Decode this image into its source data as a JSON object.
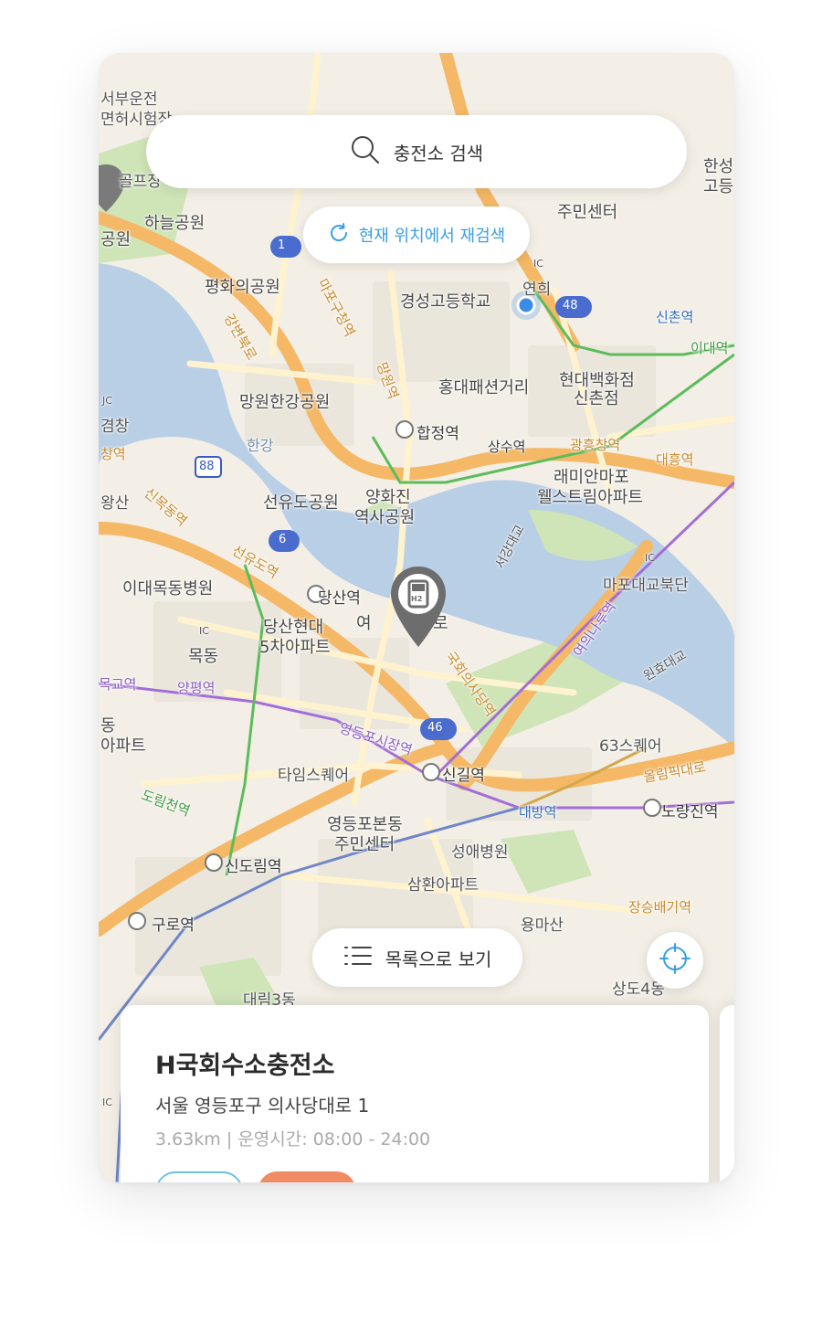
{
  "search": {
    "placeholder": "충전소 검색",
    "icon": "search-icon"
  },
  "rescan_button": {
    "label": "현재 위치에서 재검색",
    "icon": "refresh-icon"
  },
  "list_button": {
    "label": "목록으로 보기",
    "icon": "list-icon"
  },
  "location_button": {
    "icon": "crosshair-icon"
  },
  "selected_pin": {
    "label": "H2",
    "icon": "hydrogen-pin-icon"
  },
  "station_card": {
    "name": "H국회수소충전소",
    "address": "서울 영등포구 의사당대로 1",
    "distance": "3.63km",
    "separator": "|",
    "hours_label": "운영시간:",
    "hours": "08:00 - 24:00"
  },
  "map_labels": {
    "seobu": "서부운전",
    "seobu2": "면허시험장",
    "golf": "골프장",
    "haneul": "하늘공원",
    "gongwon": "공원",
    "pyeonghwa": "평화의공원",
    "mangwon_park": "망원한강공원",
    "hangang": "한강",
    "seonyudo": "선유도공원",
    "yanghwa1": "양화진",
    "yanghwa2": "역사공원",
    "gyeongseong": "경성고등학교",
    "hongdae": "홍대패션거리",
    "hyundai1": "현대백화점",
    "hyundai2": "신촌점",
    "jumin1": "주민센터",
    "hapjeong": "합정역",
    "sangsu": "상수역",
    "gwangheungchang": "광흥창역",
    "daeheung": "대흥역",
    "raemian1": "래미안마포",
    "raemian2": "웰스트림아파트",
    "mapo_bridge": "마포대교북단",
    "idae_mokdong": "이대목동병원",
    "mokdong": "목동",
    "dangsan": "당산역",
    "dangsan_hyundai1": "당산현대",
    "dangsan_hyundai2": "5차아파트",
    "yangpyeong": "양평역",
    "mokgyo": "목교역",
    "yeongdeungpo_market": "영등포시장역",
    "timesquare": "타임스퀘어",
    "singil": "신길역",
    "daebang": "대방역",
    "noryangjin": "노량진역",
    "sixty_three": "63스퀘어",
    "olympic": "올림픽대로",
    "yeongdeungpo_bon1": "영등포본동",
    "yeongdeungpo_bon2": "주민센터",
    "seongae": "성애병원",
    "samhwan": "삼환아파트",
    "yongmasan": "용마산",
    "sindorim": "신도림역",
    "guro": "구로역",
    "daerim": "대림3동",
    "dorimcheon": "도림천역",
    "jangseungbaegi": "장승배기역",
    "sangdo": "상도4동",
    "yeouinaru": "여의나루역",
    "gukhoe": "국회의사당역",
    "wonhyo": "원효대교",
    "seogang": "서강대교",
    "sinchon_station": "신촌역",
    "idae_station": "이대역",
    "hansung1": "한성",
    "hansung2": "고등",
    "yeonhui": "연희",
    "wangsan": "왕산",
    "gyeomchang": "겸창",
    "changyeok": "창역",
    "sinmokdong": "신목동역",
    "seonyudo_station": "선유도역",
    "mapogu": "마포구청역",
    "mangwon_station": "망원역",
    "gangbyeon": "강변북로",
    "route_1": "1",
    "route_48": "48",
    "route_6": "6",
    "route_46": "46",
    "route_88": "88",
    "ic": "IC",
    "jc": "JC",
    "dong": "동",
    "apt": "아파트",
    "yeo": "여",
    "ro": "로",
    "yeoui": "여의서로"
  },
  "colors": {
    "water": "#b9cfe6",
    "road_major": "#f4b866",
    "road_minor": "#fff3cf",
    "park": "#cfe5b8",
    "accent": "#3aa0e0",
    "tag_orange": "#f08b64"
  }
}
